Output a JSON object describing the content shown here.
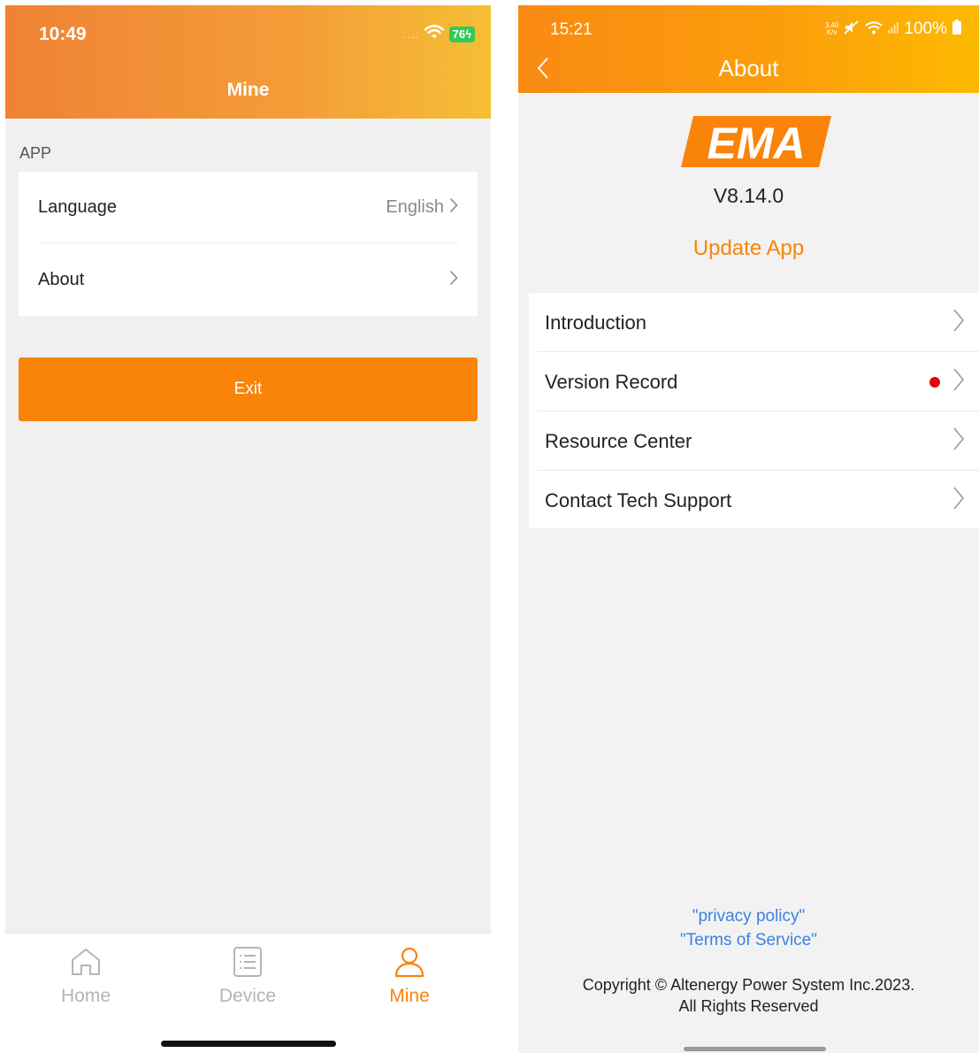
{
  "left": {
    "status": {
      "time": "10:49",
      "signal_dots": "....",
      "battery": "76"
    },
    "nav_title": "Mine",
    "section_label": "APP",
    "settings": [
      {
        "label": "Language",
        "value": "English"
      },
      {
        "label": "About",
        "value": ""
      }
    ],
    "exit_label": "Exit",
    "tabs": [
      {
        "label": "Home",
        "icon": "home-icon",
        "active": false
      },
      {
        "label": "Device",
        "icon": "list-icon",
        "active": false
      },
      {
        "label": "Mine",
        "icon": "person-icon",
        "active": true
      }
    ],
    "colors": {
      "accent": "#fa8309",
      "header_start": "#ef8234",
      "header_end": "#f5bf35"
    }
  },
  "right": {
    "status": {
      "time": "15:21",
      "net_speed_value": "3.40",
      "net_speed_unit": "K/s",
      "battery": "100%"
    },
    "nav_title": "About",
    "logo_text": "EMA",
    "version": "V8.14.0",
    "update_label": "Update App",
    "menu": [
      {
        "label": "Introduction",
        "badge": false
      },
      {
        "label": "Version Record",
        "badge": true
      },
      {
        "label": "Resource Center",
        "badge": false
      },
      {
        "label": "Contact Tech Support",
        "badge": false
      }
    ],
    "privacy_link": "\"privacy policy\"",
    "terms_link": "\"Terms of Service\"",
    "copyright_line1": "Copyright © Altenergy Power System Inc.2023.",
    "copyright_line2": "All Rights Reserved",
    "colors": {
      "accent": "#fa8309",
      "link": "#3b82e0",
      "badge": "#e8000b"
    }
  }
}
